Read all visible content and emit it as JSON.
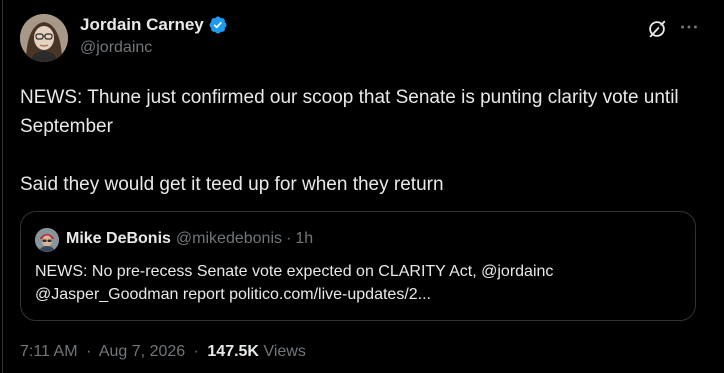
{
  "author": {
    "display_name": "Jordain Carney",
    "handle": "@jordainc",
    "verified": true
  },
  "tweet": {
    "text": "NEWS: Thune just confirmed our scoop that Senate is punting clarity vote until September\n\nSaid they would get it teed up for when they return"
  },
  "quote": {
    "author_name": "Mike DeBonis",
    "author_handle": "@mikedebonis",
    "separator": "·",
    "time": "1h",
    "text": "NEWS: No pre-recess Senate vote expected on CLARITY Act, @jordainc @Jasper_Goodman report politico.com/live-updates/2..."
  },
  "meta": {
    "time": "7:11 AM",
    "separator": "·",
    "date": "Aug 7, 2026",
    "views_count": "147.5K",
    "views_label": "Views"
  },
  "icons": {
    "verified": "verified-badge-icon",
    "grok": "grok-icon",
    "more": "more-options-icon"
  },
  "colors": {
    "background": "#000000",
    "text_primary": "#e7e9ea",
    "text_secondary": "#71767b",
    "border": "#2f3336",
    "verified_blue": "#1d9bf0"
  }
}
